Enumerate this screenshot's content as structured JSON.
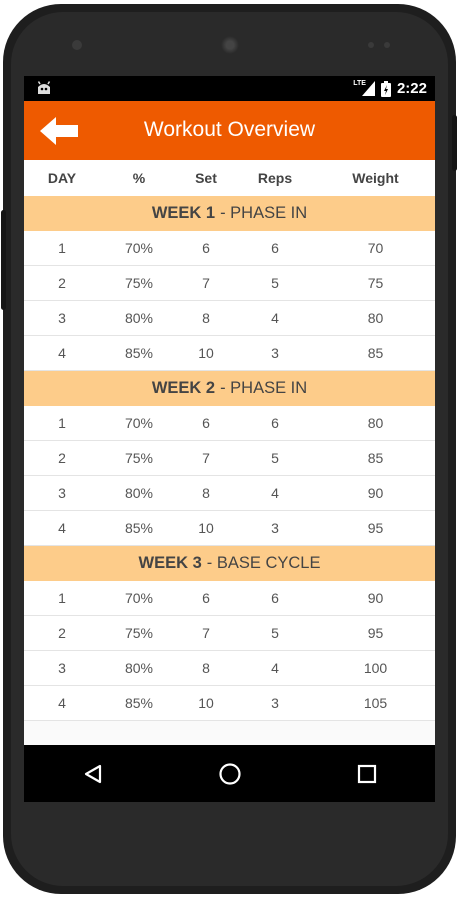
{
  "status_bar": {
    "time": "2:22",
    "network": "LTE"
  },
  "app_bar": {
    "title": "Workout Overview"
  },
  "columns": [
    "DAY",
    "%",
    "Set",
    "Reps",
    "Weight"
  ],
  "weeks": [
    {
      "number": "WEEK 1",
      "phase": "- PHASE IN",
      "rows": [
        [
          "1",
          "70%",
          "6",
          "6",
          "70"
        ],
        [
          "2",
          "75%",
          "7",
          "5",
          "75"
        ],
        [
          "3",
          "80%",
          "8",
          "4",
          "80"
        ],
        [
          "4",
          "85%",
          "10",
          "3",
          "85"
        ]
      ]
    },
    {
      "number": "WEEK 2",
      "phase": "- PHASE IN",
      "rows": [
        [
          "1",
          "70%",
          "6",
          "6",
          "80"
        ],
        [
          "2",
          "75%",
          "7",
          "5",
          "85"
        ],
        [
          "3",
          "80%",
          "8",
          "4",
          "90"
        ],
        [
          "4",
          "85%",
          "10",
          "3",
          "95"
        ]
      ]
    },
    {
      "number": "WEEK 3",
      "phase": "- BASE CYCLE",
      "rows": [
        [
          "1",
          "70%",
          "6",
          "6",
          "90"
        ],
        [
          "2",
          "75%",
          "7",
          "5",
          "95"
        ],
        [
          "3",
          "80%",
          "8",
          "4",
          "100"
        ],
        [
          "4",
          "85%",
          "10",
          "3",
          "105"
        ]
      ]
    }
  ],
  "colors": {
    "accent": "#ee5a00",
    "week_header": "#fdcc8a"
  },
  "icons": {
    "back": "arrow-left-icon",
    "nav_back": "triangle-back-icon",
    "home": "circle-home-icon",
    "recents": "square-recents-icon"
  }
}
